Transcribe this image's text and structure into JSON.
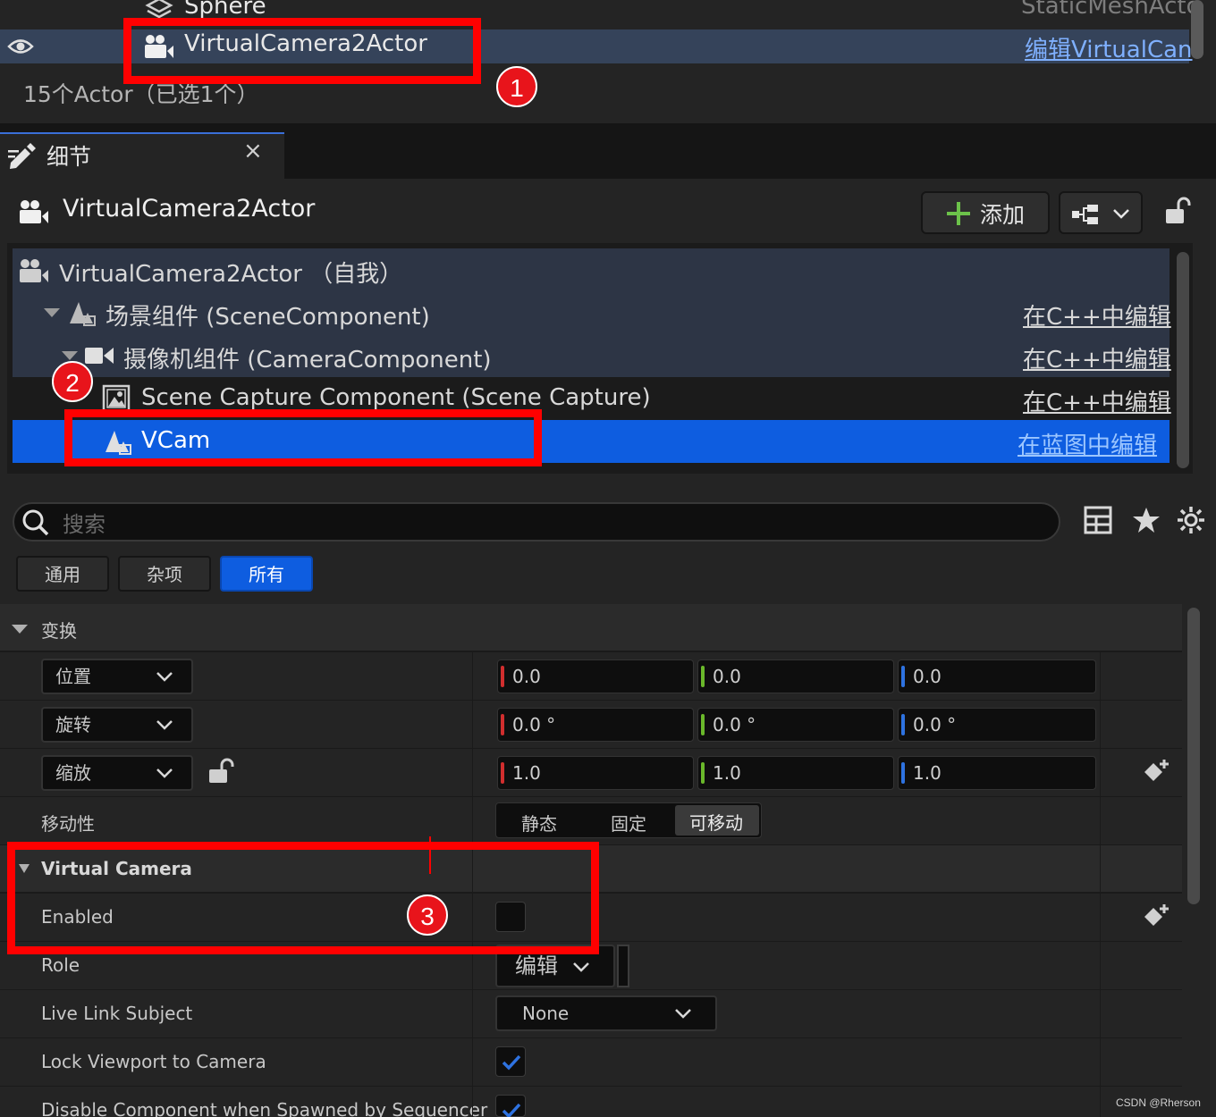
{
  "colors": {
    "accent": "#0e5de0",
    "selection_row": "#35435a",
    "highlight_red": "#ff0000",
    "x_axis": "#d12e2e",
    "y_axis": "#6ab82a",
    "z_axis": "#2e72e0",
    "add_plus": "#6cc24a"
  },
  "outliner": {
    "rows": [
      {
        "name": "Sphere",
        "type": "StaticMeshActo",
        "icon": "mesh-icon"
      },
      {
        "name": "VirtualCamera2Actor",
        "type_link": "编辑VirtualCan",
        "icon": "camera-actor-icon",
        "selected": true
      }
    ],
    "actor_count": "15个Actor（已选1个）"
  },
  "details_tab": {
    "label": "细节",
    "close": "×"
  },
  "header": {
    "actor_name": "VirtualCamera2Actor",
    "add_label": "添加"
  },
  "components": [
    {
      "label": "VirtualCamera2Actor （自我）",
      "icon": "camera-actor-icon",
      "link": ""
    },
    {
      "label": "场景组件 (SceneComponent)",
      "icon": "scene-component-icon",
      "link": "在C++中编辑"
    },
    {
      "label": "摄像机组件 (CameraComponent)",
      "icon": "camera-component-icon",
      "link": "在C++中编辑"
    },
    {
      "label": "Scene Capture Component (Scene Capture)",
      "icon": "scene-capture-icon",
      "link": "在C++中编辑"
    },
    {
      "label": "VCam",
      "icon": "scene-component-icon",
      "link": "在蓝图中编辑",
      "selected": true
    }
  ],
  "search": {
    "placeholder": "搜索"
  },
  "filters": [
    {
      "label": "通用",
      "active": false
    },
    {
      "label": "杂项",
      "active": false
    },
    {
      "label": "所有",
      "active": true
    }
  ],
  "transform": {
    "category": "变换",
    "location": {
      "label": "位置",
      "x": "0.0",
      "y": "0.0",
      "z": "0.0"
    },
    "rotation": {
      "label": "旋转",
      "x": "0.0 °",
      "y": "0.0 °",
      "z": "0.0 °"
    },
    "scale": {
      "label": "缩放",
      "x": "1.0",
      "y": "1.0",
      "z": "1.0"
    },
    "mobility": {
      "label": "移动性",
      "options": [
        "静态",
        "固定",
        "可移动"
      ],
      "selected": "可移动"
    }
  },
  "virtual_camera": {
    "category": "Virtual Camera",
    "enabled": {
      "label": "Enabled",
      "checked": false
    },
    "role": {
      "label": "Role",
      "value": "编辑"
    },
    "live_link": {
      "label": "Live Link Subject",
      "value": "None"
    },
    "lock_viewport": {
      "label": "Lock Viewport to Camera",
      "checked": true
    },
    "disable_component": {
      "label": "Disable Component when Spawned by Sequencer",
      "checked": true
    }
  },
  "annotations": [
    "1",
    "2",
    "3"
  ],
  "watermark": "CSDN @Rherson"
}
